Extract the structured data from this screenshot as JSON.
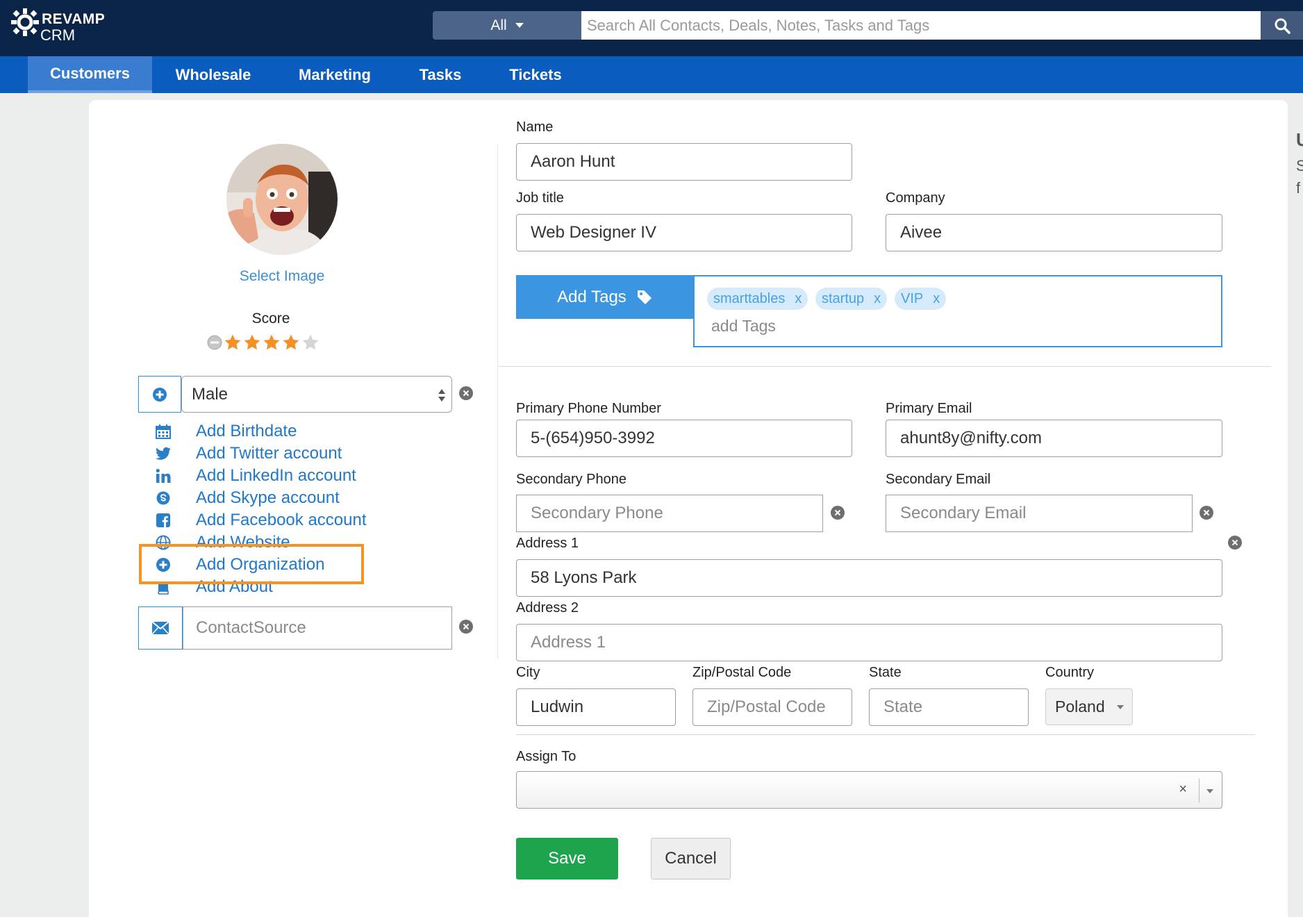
{
  "brand": {
    "name_line1": "REVAMP",
    "name_line2": "CRM"
  },
  "search": {
    "scope": "All",
    "placeholder": "Search All Contacts, Deals, Notes, Tasks and Tags"
  },
  "nav": [
    {
      "label": "Customers",
      "active": true
    },
    {
      "label": "Wholesale"
    },
    {
      "label": "Marketing"
    },
    {
      "label": "Tasks"
    },
    {
      "label": "Tickets"
    }
  ],
  "profile": {
    "select_image": "Select Image",
    "score_label": "Score",
    "score": {
      "value": 4,
      "max": 5
    },
    "gender": "Male",
    "links": [
      {
        "label": "Add Birthdate",
        "icon": "calendar-icon"
      },
      {
        "label": "Add Twitter account",
        "icon": "twitter-icon"
      },
      {
        "label": "Add LinkedIn account",
        "icon": "linkedin-icon"
      },
      {
        "label": "Add Skype account",
        "icon": "skype-icon"
      },
      {
        "label": "Add Facebook account",
        "icon": "facebook-icon"
      },
      {
        "label": "Add Website",
        "icon": "globe-icon"
      },
      {
        "label": "Add Organization",
        "icon": "plus-circle-icon"
      },
      {
        "label": "Add About",
        "icon": "book-icon"
      }
    ],
    "contact_source_placeholder": "ContactSource"
  },
  "form": {
    "name": {
      "label": "Name",
      "value": "Aaron Hunt"
    },
    "job_title": {
      "label": "Job title",
      "value": "Web Designer IV"
    },
    "company": {
      "label": "Company",
      "value": "Aivee"
    },
    "tags": {
      "button": "Add Tags",
      "items": [
        "smarttables",
        "startup",
        "VIP"
      ],
      "remove_glyph": "x",
      "placeholder": "add Tags"
    },
    "primary_phone": {
      "label": "Primary Phone Number",
      "value": "5-(654)950-3992"
    },
    "primary_email": {
      "label": "Primary Email",
      "value": "ahunt8y@nifty.com"
    },
    "secondary_phone": {
      "label": "Secondary Phone",
      "placeholder": "Secondary Phone"
    },
    "secondary_email": {
      "label": "Secondary Email",
      "placeholder": "Secondary Email"
    },
    "address1": {
      "label": "Address 1",
      "value": "58 Lyons Park"
    },
    "address2": {
      "label": "Address 2",
      "placeholder": "Address 1"
    },
    "city": {
      "label": "City",
      "value": "Ludwin"
    },
    "zip": {
      "label": "Zip/Postal Code",
      "placeholder": "Zip/Postal Code"
    },
    "state": {
      "label": "State",
      "placeholder": "State"
    },
    "country": {
      "label": "Country",
      "value": "Poland"
    },
    "assign_to": {
      "label": "Assign To",
      "value": "",
      "clear_glyph": "×"
    },
    "save": "Save",
    "cancel": "Cancel"
  },
  "edge_glyphs": [
    "U",
    "S",
    "f"
  ],
  "colors": {
    "header": "#0b2548",
    "nav": "#0b5cbf",
    "accent": "#3b95e0",
    "highlight": "#f7931e",
    "save": "#1ea44c"
  }
}
